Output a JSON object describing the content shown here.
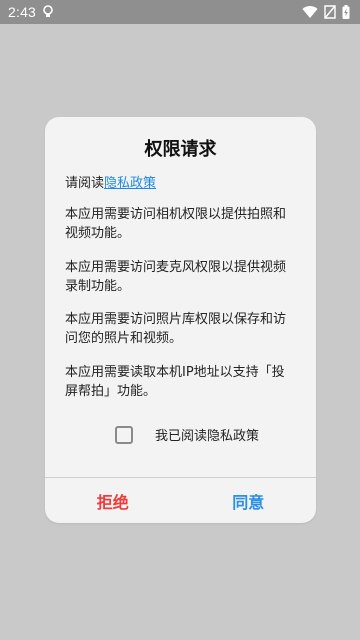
{
  "status_bar": {
    "time": "2:43"
  },
  "dialog": {
    "title": "权限请求",
    "read_prefix": "请阅读",
    "policy_link": "隐私政策",
    "paragraphs": [
      "本应用需要访问相机权限以提供拍照和视频功能。",
      "本应用需要访问麦克风权限以提供视频录制功能。",
      "本应用需要访问照片库权限以保存和访问您的照片和视频。",
      "本应用需要读取本机IP地址以支持「投屏帮拍」功能。"
    ],
    "checkbox": {
      "label": "我已阅读隐私政策",
      "checked": false
    },
    "buttons": {
      "reject": "拒绝",
      "agree": "同意"
    }
  },
  "colors": {
    "overlay": "#c9c9c9",
    "status_bar": "#8f8f8f",
    "dialog_bg": "#f3f3f3",
    "link": "#1e88e5",
    "reject": "#f23b3b",
    "agree": "#2a8fe6"
  },
  "icons": [
    "lightbulb-icon",
    "wifi-icon",
    "no-sim-icon",
    "battery-charging-icon"
  ]
}
